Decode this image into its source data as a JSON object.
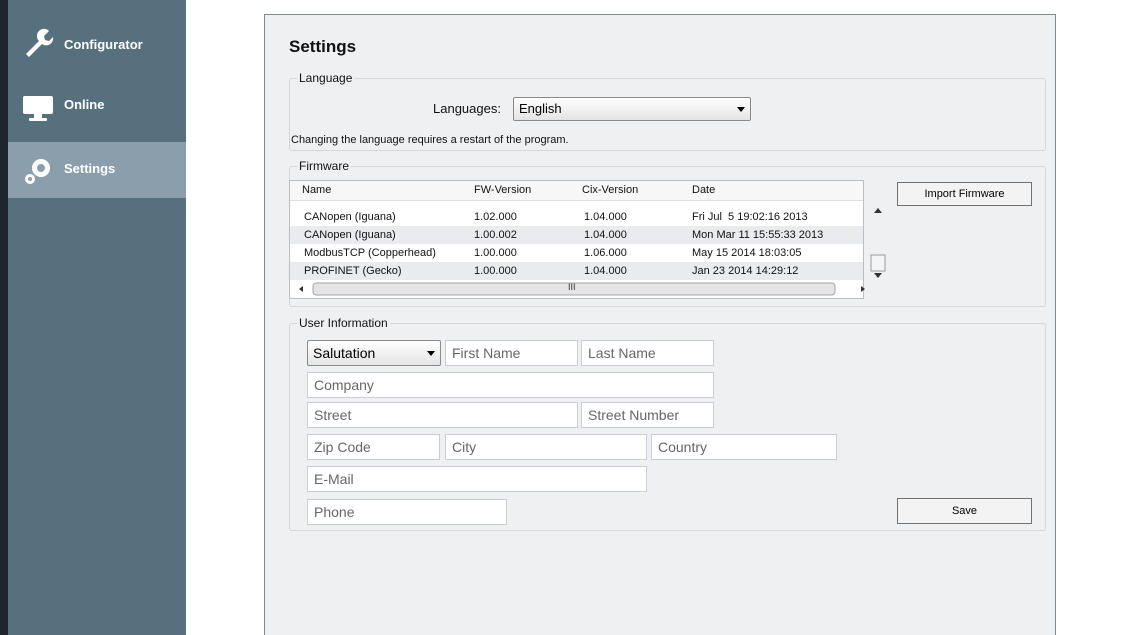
{
  "sidebar": {
    "items": [
      {
        "label": "Configurator",
        "icon": "wrench-icon",
        "active": false
      },
      {
        "label": "Online",
        "icon": "monitor-icon",
        "active": false
      },
      {
        "label": "Settings",
        "icon": "gears-icon",
        "active": true
      }
    ]
  },
  "settings": {
    "title": "Settings",
    "language": {
      "group_title": "Language",
      "label": "Languages:",
      "selected": "English",
      "note": "Changing the language requires a restart of the program."
    },
    "firmware": {
      "group_title": "Firmware",
      "columns": [
        "Name",
        "FW-Version",
        "Cix-Version",
        "Date"
      ],
      "rows": [
        {
          "name": "CANopen (Iguana)",
          "fw": "1.02.000",
          "cix": "1.04.000",
          "date": "Fri Jul  5 19:02:16 2013"
        },
        {
          "name": "CANopen (Iguana)",
          "fw": "1.00.002",
          "cix": "1.04.000",
          "date": "Mon Mar 11 15:55:33 2013"
        },
        {
          "name": "ModbusTCP (Copperhead)",
          "fw": "1.00.000",
          "cix": "1.06.000",
          "date": "May 15 2014 18:03:05"
        },
        {
          "name": "PROFINET (Gecko)",
          "fw": "1.00.000",
          "cix": "1.04.000",
          "date": "Jan 23 2014 14:29:12"
        }
      ],
      "hscroll_mark": "III",
      "import_button": "Import Firmware"
    },
    "user_info": {
      "group_title": "User Information",
      "salutation": "Salutation",
      "placeholders": {
        "first_name": "First Name",
        "last_name": "Last Name",
        "company": "Company",
        "street": "Street",
        "street_number": "Street Number",
        "zip": "Zip Code",
        "city": "City",
        "country": "Country",
        "email": "E-Mail",
        "phone": "Phone"
      },
      "save_button": "Save"
    }
  }
}
